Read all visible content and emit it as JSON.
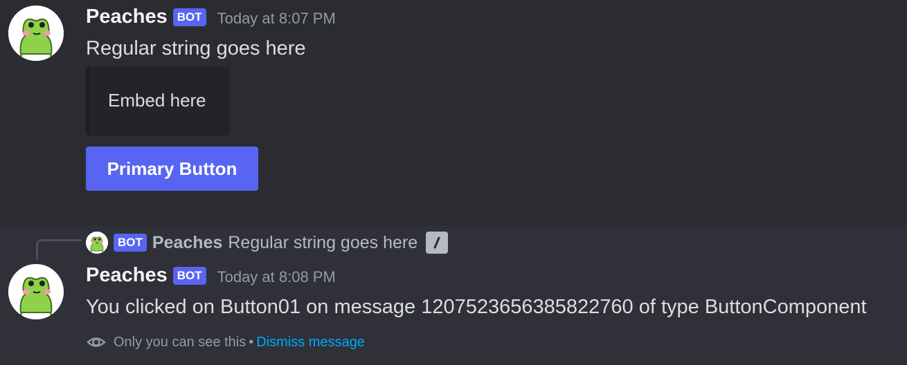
{
  "messages": [
    {
      "username": "Peaches",
      "bot_tag": "BOT",
      "timestamp": "Today at 8:07 PM",
      "content": "Regular string goes here",
      "embed": {
        "text": "Embed here"
      },
      "button": {
        "label": "Primary Button"
      }
    },
    {
      "reply": {
        "bot_tag": "BOT",
        "username": "Peaches",
        "content": "Regular string goes here",
        "icon": "slash-command-icon"
      },
      "username": "Peaches",
      "bot_tag": "BOT",
      "timestamp": "Today at 8:08 PM",
      "content": "You clicked on Button01 on message 1207523656385822760 of type ButtonComponent",
      "ephemeral": {
        "icon": "eye-icon",
        "notice": "Only you can see this",
        "separator": "•",
        "dismiss_label": "Dismiss message"
      }
    }
  ],
  "colors": {
    "background": "#2b2c31",
    "highlight_background": "#2f3038",
    "blurple": "#5865f2",
    "link": "#00a8fc"
  }
}
